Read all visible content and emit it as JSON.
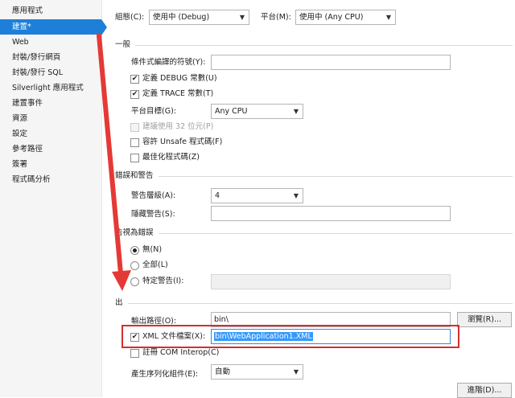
{
  "sidebar": {
    "items": [
      {
        "label": "應用程式"
      },
      {
        "label": "建置*"
      },
      {
        "label": "Web"
      },
      {
        "label": "封裝/發行網頁"
      },
      {
        "label": "封裝/發行 SQL"
      },
      {
        "label": "Silverlight 應用程式"
      },
      {
        "label": "建置事件"
      },
      {
        "label": "資源"
      },
      {
        "label": "設定"
      },
      {
        "label": "參考路徑"
      },
      {
        "label": "簽署"
      },
      {
        "label": "程式碼分析"
      }
    ],
    "selected_index": 1
  },
  "header": {
    "config_label": "組態(C):",
    "config_value": "使用中 (Debug)",
    "platform_label": "平台(M):",
    "platform_value": "使用中 (Any CPU)"
  },
  "general": {
    "section_title": "一般",
    "symbols_label": "條件式編譯的符號(Y):",
    "symbols_value": "",
    "define_debug_label": "定義 DEBUG 常數(U)",
    "define_debug_checked": true,
    "define_trace_label": "定義 TRACE 常數(T)",
    "define_trace_checked": true,
    "platform_target_label": "平台目標(G):",
    "platform_target_value": "Any CPU",
    "prefer32_label": "建議使用 32 位元(P)",
    "prefer32_checked": false,
    "unsafe_label": "容許 Unsafe 程式碼(F)",
    "unsafe_checked": false,
    "optimize_label": "最佳化程式碼(Z)",
    "optimize_checked": false
  },
  "errors": {
    "section_title": "錯誤和警告",
    "warning_level_label": "警告層級(A):",
    "warning_level_value": "4",
    "suppress_label": "隱藏警告(S):",
    "suppress_value": ""
  },
  "treat_warnings": {
    "section_title": "告視為錯誤",
    "none_label": "無(N)",
    "none_selected": true,
    "all_label": "全部(L)",
    "specific_label": "特定警告(I):",
    "specific_value": ""
  },
  "output": {
    "section_title": "出",
    "output_path_label": "輸出路徑(O):",
    "output_path_value": "bin\\",
    "browse_label": "瀏覽(R)...",
    "xml_doc_label": "XML 文件檔案(X):",
    "xml_doc_checked": true,
    "xml_doc_value": "bin\\WebApplication1.XML",
    "com_interop_label": "註冊 COM Interop(C)",
    "com_interop_checked": false,
    "serialization_label": "產生序列化組件(E):",
    "serialization_value": "自動",
    "advanced_label": "進階(D)..."
  },
  "annotation": {
    "arrow_color": "#e53935",
    "box_color": "#d32f2f"
  }
}
